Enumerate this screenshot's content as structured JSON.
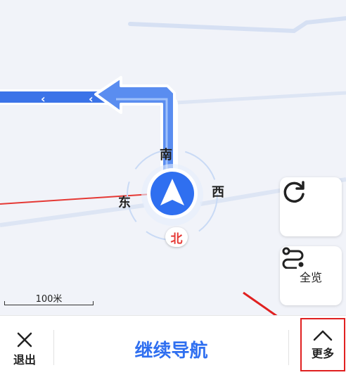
{
  "map": {
    "compass": {
      "south": "南",
      "east": "东",
      "west": "西",
      "north": "北"
    },
    "scale_label": "100米"
  },
  "side_buttons": {
    "refresh_icon": "refresh-icon",
    "overview_label": "全览"
  },
  "bottom_bar": {
    "exit_label": "退出",
    "continue_label": "继续导航",
    "more_label": "更多"
  },
  "colors": {
    "route": "#3b73e8",
    "accent_text": "#2f6ff0",
    "annotation": "#e02020"
  }
}
